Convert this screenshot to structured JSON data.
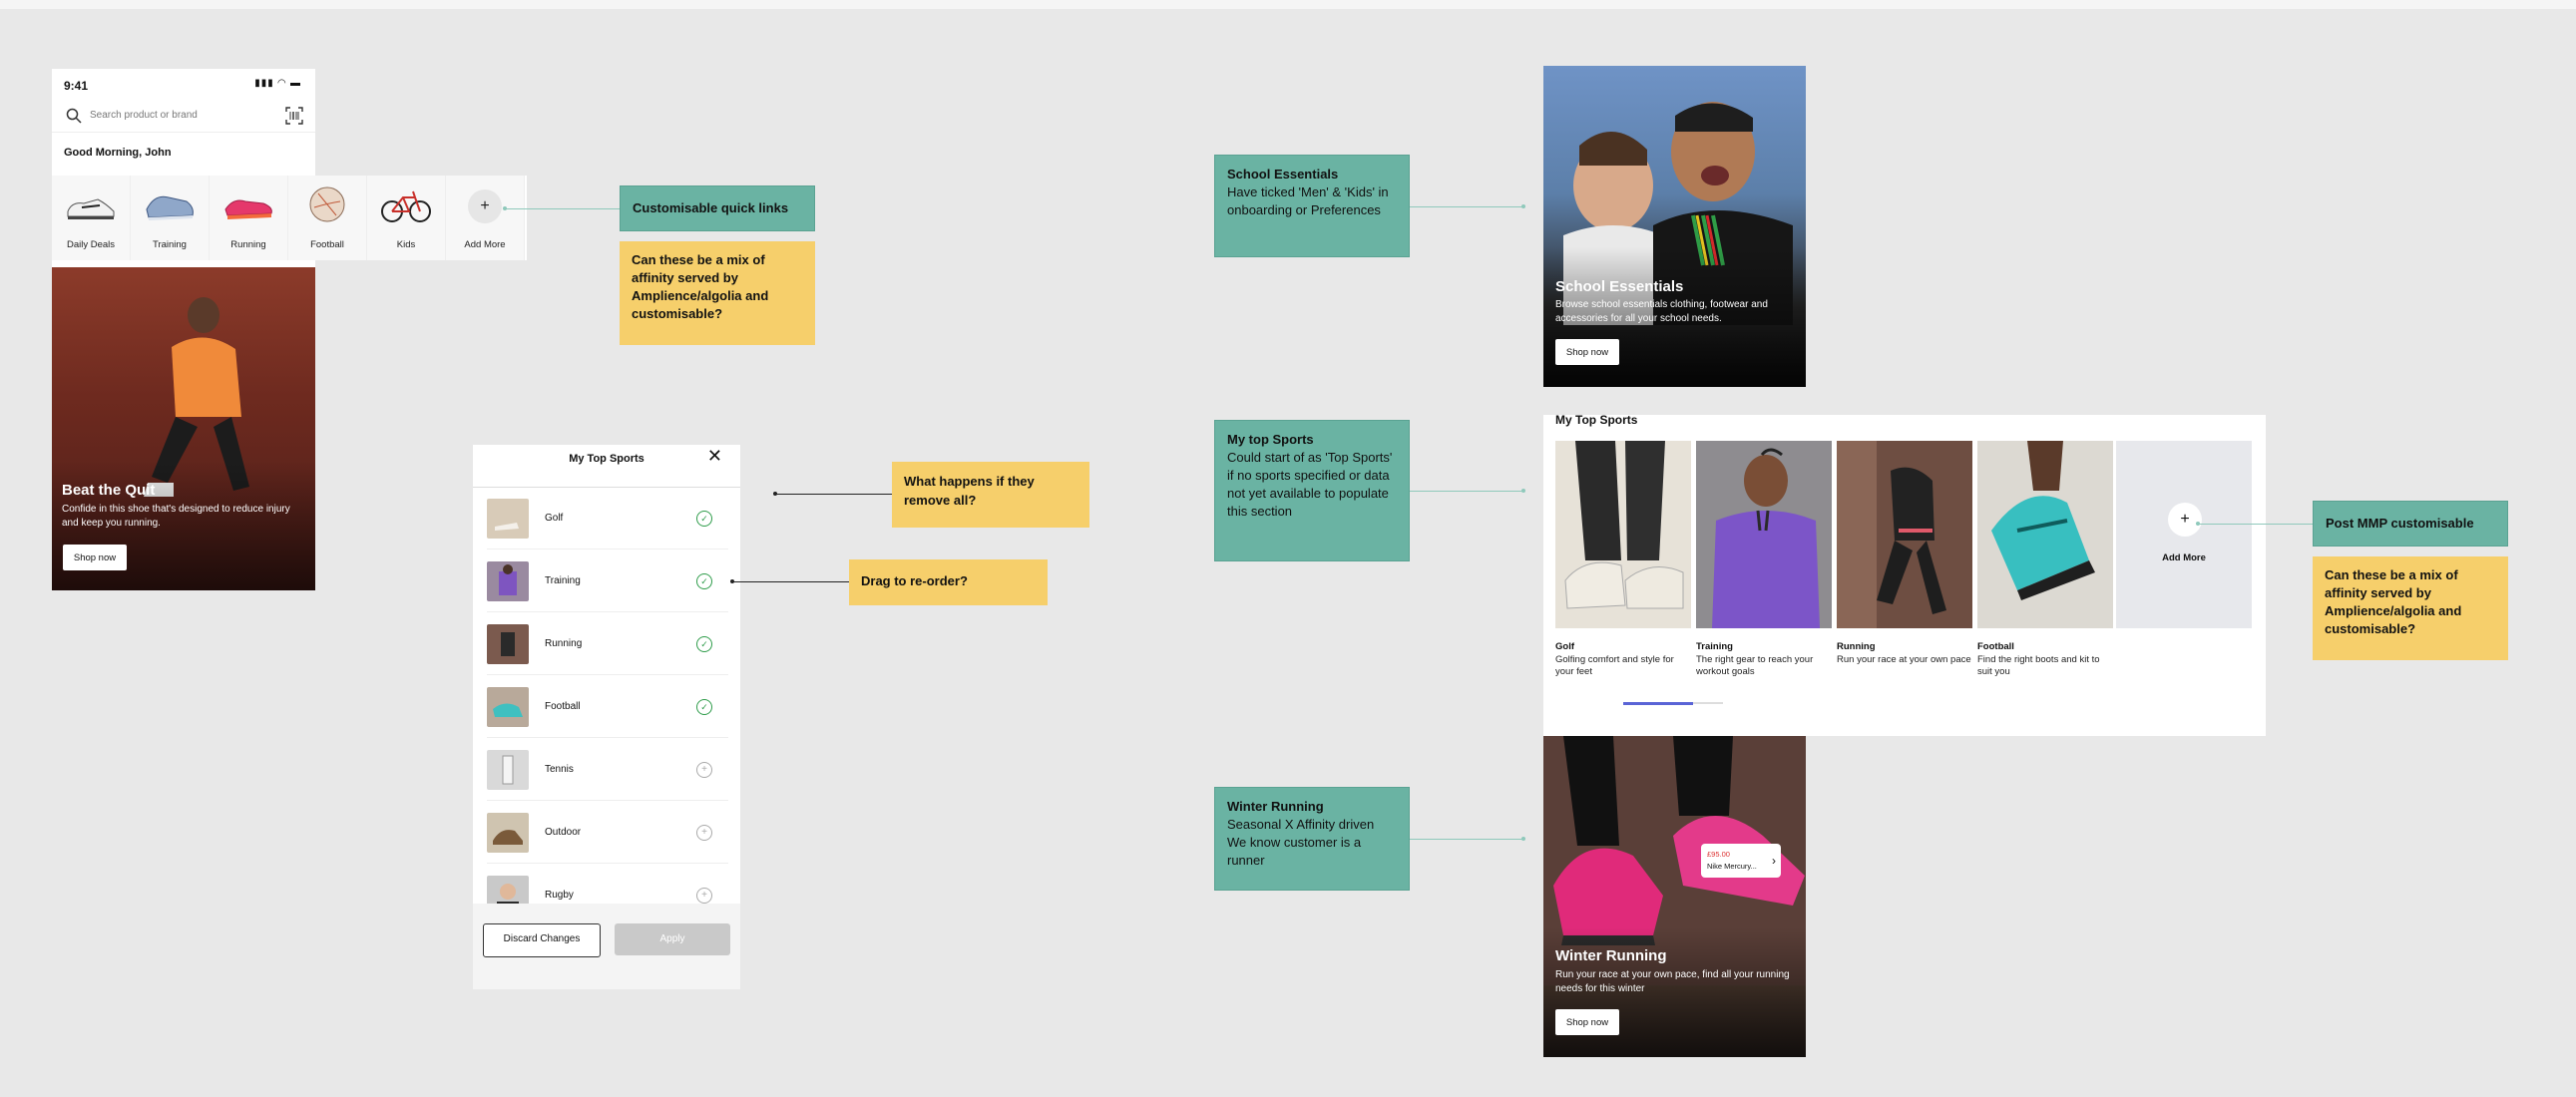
{
  "phone": {
    "time": "9:41",
    "search_placeholder": "Search product or brand",
    "greeting": "Good Morning, John",
    "quick_links": [
      {
        "label": "Daily Deals",
        "icon": "sneaker-icon"
      },
      {
        "label": "Training",
        "icon": "training-shoe-icon"
      },
      {
        "label": "Running",
        "icon": "running-shoe-icon"
      },
      {
        "label": "Football",
        "icon": "football-icon"
      },
      {
        "label": "Kids",
        "icon": "bike-icon"
      },
      {
        "label": "Add More",
        "icon": "plus-icon"
      }
    ],
    "hero": {
      "title": "Beat the Quit",
      "subtitle": "Confide in this shoe that's designed to reduce injury and keep you running.",
      "button": "Shop now"
    }
  },
  "notes": {
    "quick_links": "Customisable quick links",
    "quick_links_question": "Can these be a mix of affinity served by Amplience/algolia and customisable?",
    "remove_all": "What happens if they remove all?",
    "reorder": "Drag to re-order?",
    "school_title": "School Essentials",
    "school_body": "Have ticked 'Men' & 'Kids' in onboarding or Preferences",
    "top_sports_title": "My top Sports",
    "top_sports_body": "Could start of as 'Top Sports' if no sports specified or data not yet available to populate this section",
    "winter_title": "Winter Running",
    "winter_body": "Seasonal X Affinity driven We know customer is a runner",
    "post_mmp": "Post MMP customisable",
    "post_mmp_question": "Can these be a mix of affinity served by Amplience/algolia and customisable?"
  },
  "modal": {
    "title": "My Top Sports",
    "rows": [
      {
        "name": "Golf",
        "selected": true
      },
      {
        "name": "Training",
        "selected": true
      },
      {
        "name": "Running",
        "selected": true
      },
      {
        "name": "Football",
        "selected": true
      },
      {
        "name": "Tennis",
        "selected": false
      },
      {
        "name": "Outdoor",
        "selected": false
      },
      {
        "name": "Rugby",
        "selected": false
      }
    ],
    "discard": "Discard Changes",
    "apply": "Apply"
  },
  "cards": {
    "school": {
      "title": "School Essentials",
      "subtitle": "Browse school essentials clothing, footwear and accessories for all your school needs.",
      "button": "Shop now"
    },
    "top_sports": {
      "title": "My Top Sports",
      "items": [
        {
          "title": "Golf",
          "desc": "Golfing comfort and style for your feet"
        },
        {
          "title": "Training",
          "desc": "The right gear to reach your workout goals"
        },
        {
          "title": "Running",
          "desc": "Run your race at your own pace"
        },
        {
          "title": "Football",
          "desc": "Find the right boots and kit to suit you"
        }
      ],
      "add_more": "Add More"
    },
    "winter": {
      "title": "Winter Running",
      "subtitle": "Run your race at your own pace, find all your running needs for this winter",
      "button": "Shop now",
      "tag_price": "£95.00",
      "tag_name": "Nike Mercury..."
    }
  }
}
